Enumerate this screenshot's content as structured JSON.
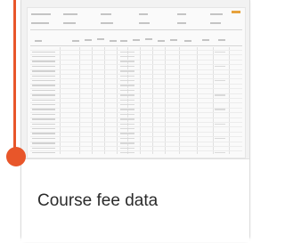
{
  "card": {
    "title": "Course fee data",
    "thumbnail_icon": "spreadsheet-preview"
  },
  "timeline": {
    "accent_color": "#e8562a"
  }
}
